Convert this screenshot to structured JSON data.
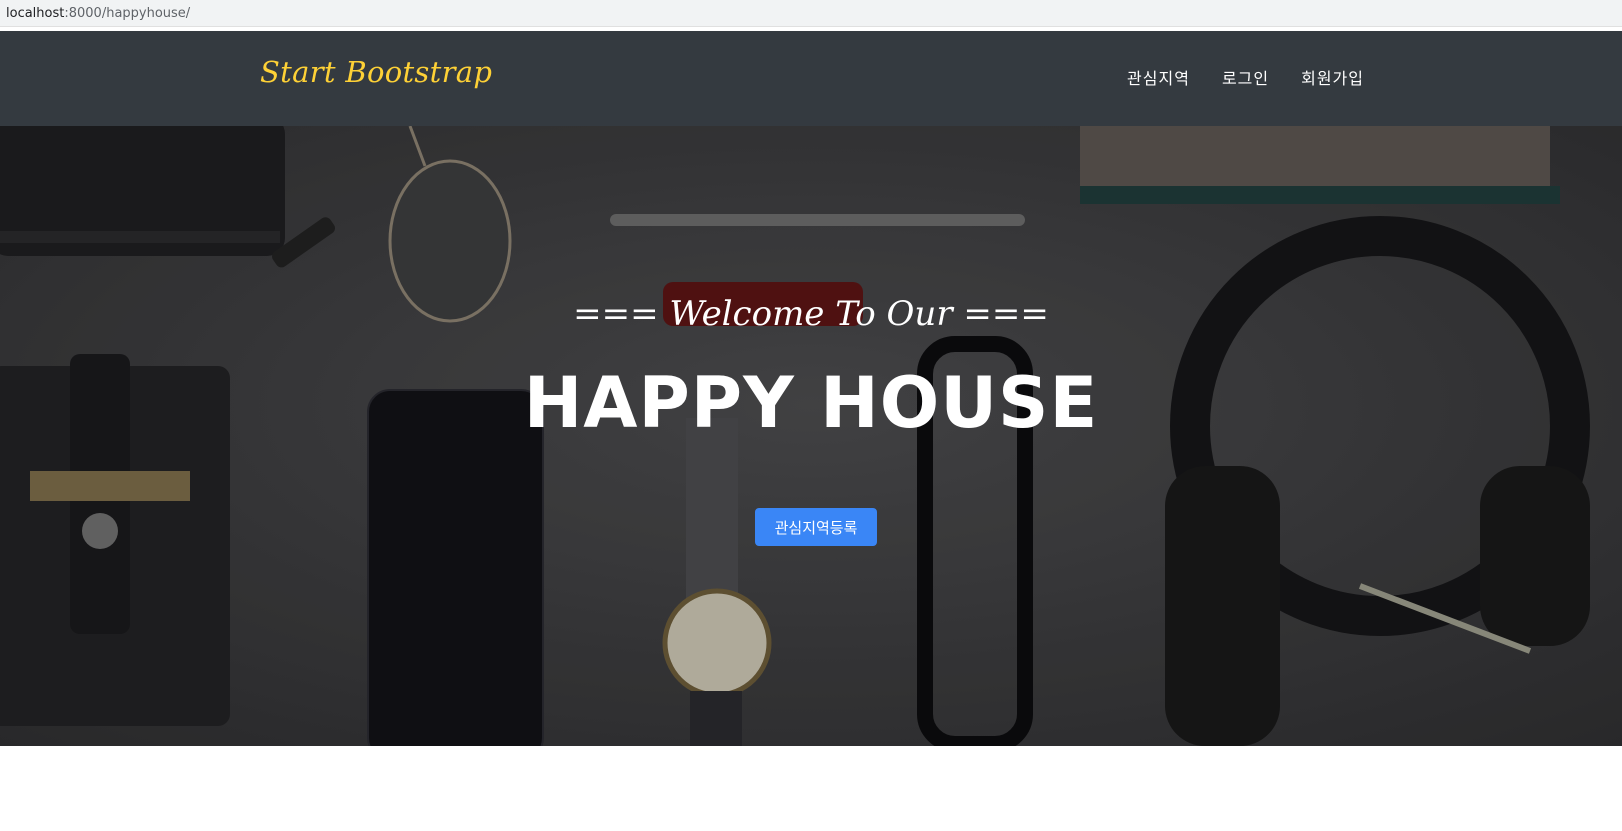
{
  "browser": {
    "url_host": "localhost",
    "url_rest": ":8000/happyhouse/"
  },
  "navbar": {
    "brand": "Start Bootstrap",
    "links": [
      "관심지역",
      "로그인",
      "회원가입"
    ]
  },
  "hero": {
    "subheading_prefix": "=== ",
    "subheading_italic": "Welcome To Our",
    "subheading_suffix": " ===",
    "heading": "HAPPY HOUSE",
    "button_label": "관심지역등록"
  },
  "colors": {
    "navbar_bg": "#343a40",
    "brand": "#fed136",
    "button": "#3a86f6"
  }
}
